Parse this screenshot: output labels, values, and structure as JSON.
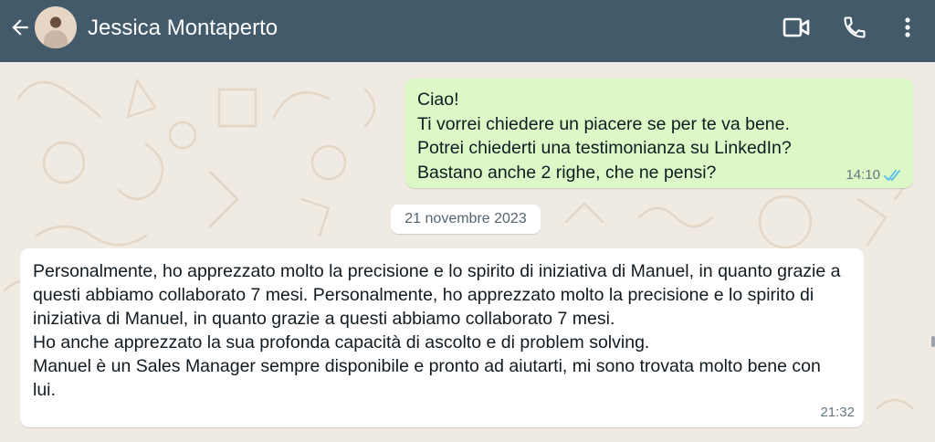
{
  "header": {
    "contact_name": "Jessica Montaperto",
    "bg_color": "#435a6a"
  },
  "icons": {
    "back": "arrow-left-icon",
    "video": "video-camera-icon",
    "call": "phone-icon",
    "more": "more-vertical-icon"
  },
  "messages": [
    {
      "direction": "outgoing",
      "text": "Ciao!\nTi vorrei chiedere un piacere se per te va bene.\nPotrei chiederti una testimonianza su LinkedIn?\nBastano anche 2 righe, che ne pensi?",
      "time": "14:10",
      "status": "read",
      "bubble_color": "#dcf8c6"
    },
    {
      "direction": "incoming",
      "text": "Personalmente, ho apprezzato molto la precisione e lo spirito di iniziativa di Manuel, in quanto grazie a questi abbiamo collaborato 7 mesi. Personalmente, ho apprezzato molto la precisione e lo spirito di iniziativa di Manuel, in quanto grazie a questi abbiamo collaborato 7 mesi.\nHo anche apprezzato la sua profonda capacità di ascolto e di problem solving.\nManuel è un Sales Manager sempre disponibile e pronto ad aiutarti, mi sono trovata molto bene con lui.",
      "time": "21:32",
      "bubble_color": "#ffffff"
    }
  ],
  "date_separator": "21 novembre 2023",
  "colors": {
    "chat_background": "#efeae2",
    "read_ticks": "#53bdeb"
  }
}
